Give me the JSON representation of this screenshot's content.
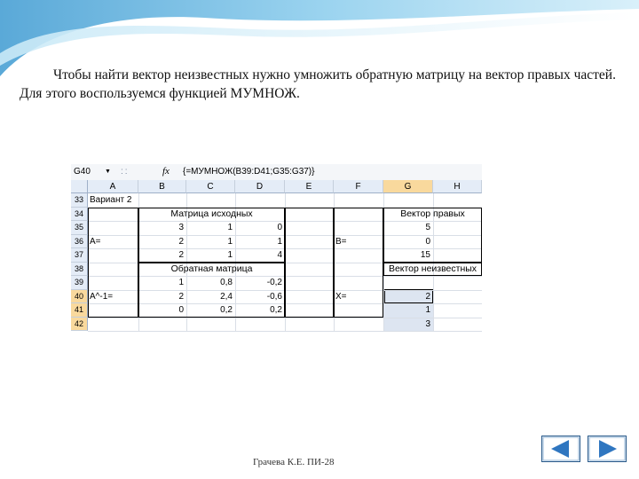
{
  "slide": {
    "intro_text": "Чтобы найти вектор неизвестных нужно умножить обратную матрицу на вектор правых частей. Для этого воспользуемся функцией МУМНОЖ.",
    "footer": "Грачева К.Е. ПИ-28",
    "nav": {
      "prev_icon": "arrow-left-icon",
      "next_icon": "arrow-right-icon"
    }
  },
  "spreadsheet": {
    "name_box": "G40",
    "name_box_dropdown": "▼",
    "formula_sep": "::",
    "fx_label": "fx",
    "formula": "{=МУМНОЖ(B39:D41;G35:G37)}",
    "columns": [
      "A",
      "B",
      "C",
      "D",
      "E",
      "F",
      "G",
      "H"
    ],
    "rows": [
      "33",
      "34",
      "35",
      "36",
      "37",
      "38",
      "39",
      "40",
      "41",
      "42"
    ],
    "labels": {
      "variant": "Вариант 2",
      "matrix_header": "Матрица исходных",
      "right_header": "Вектор правых",
      "a_label": "A=",
      "b_label": "B=",
      "inverse_header": "Обратная матрица",
      "unknown_header": "Вектор неизвестных",
      "ainv_label": "A^-1=",
      "x_label": "X="
    },
    "matrix": [
      [
        "3",
        "1",
        "0"
      ],
      [
        "2",
        "1",
        "1"
      ],
      [
        "2",
        "1",
        "4"
      ]
    ],
    "right_vector": [
      "5",
      "0",
      "15"
    ],
    "inverse": [
      [
        "1",
        "0,8",
        "-0,2"
      ],
      [
        "2",
        "2,4",
        "-0,6"
      ],
      [
        "0",
        "0,2",
        "0,2"
      ]
    ],
    "result": [
      "2",
      "1",
      "3"
    ]
  },
  "colors": {
    "header_bg": "#e4ecf7",
    "selected_header": "#f9d99d",
    "top_band": "#6fb7e0"
  }
}
